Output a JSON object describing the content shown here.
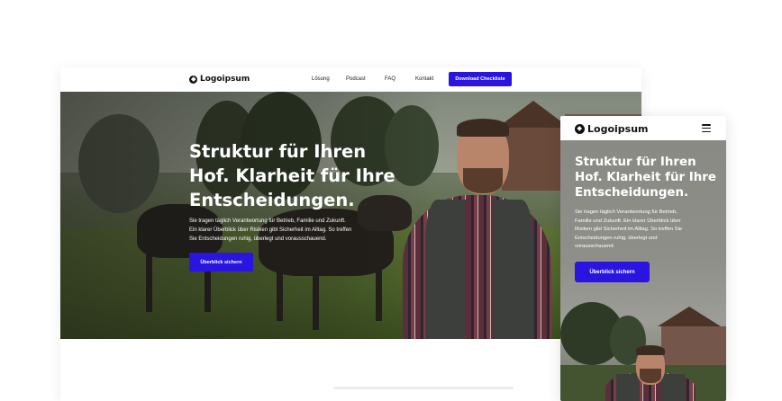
{
  "brand": {
    "name": "Logoipsum",
    "accent": "#2a14e0"
  },
  "desktop": {
    "nav": {
      "items": [
        "Lösung",
        "Podcast",
        "FAQ",
        "Kontakt"
      ],
      "cta": "Download Checkliste"
    },
    "hero": {
      "title_lines": [
        "Struktur für Ihren",
        "Hof. Klarheit für Ihre",
        "Entscheidungen."
      ],
      "text_lines": [
        "Sie tragen täglich Verantwortung für Betrieb, Familie und Zukunft.",
        "Ein klarer Überblick über Risiken gibt Sicherheit im Alltag. So treffen",
        "Sie Entscheidungen ruhig, überlegt und vorausschauend."
      ],
      "button": "Überblick sichern"
    }
  },
  "mobile": {
    "menu_icon": "hamburger-menu-icon",
    "hero": {
      "title_lines": [
        "Struktur für Ihren",
        "Hof. Klarheit für Ihre",
        "Entscheidungen."
      ],
      "text_lines": [
        "Sie tragen täglich Verantwortung für Betrieb,",
        "Familie und Zukunft. Ein klarer Überblick über",
        "Risiken gibt Sicherheit im Alltag. So treffen Sie",
        "Entscheidungen ruhig, überlegt und",
        "vorausschauend."
      ],
      "button": "Überblick sichern"
    }
  }
}
